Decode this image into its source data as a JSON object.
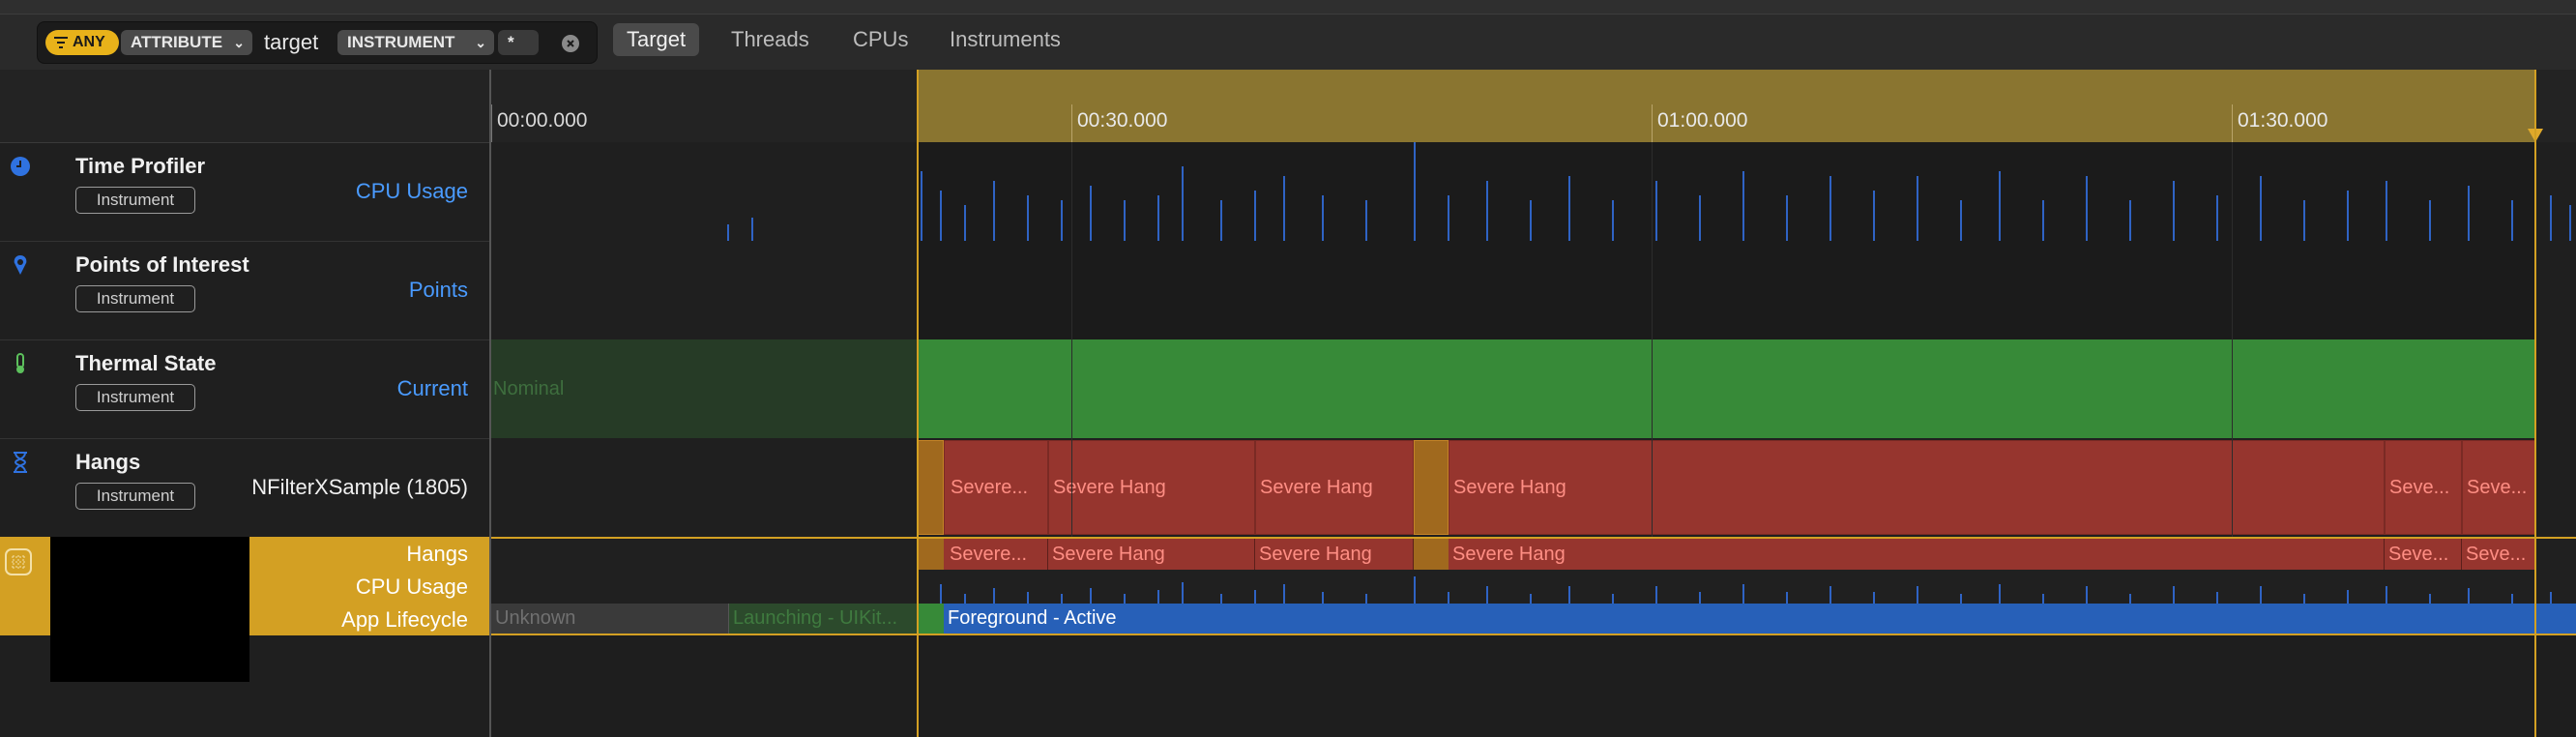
{
  "filter": {
    "any_label": "ANY",
    "attribute_label": "ATTRIBUTE",
    "target_text": "target",
    "instrument_label": "INSTRUMENT",
    "star_label": "*"
  },
  "tabs": [
    "Target",
    "Threads",
    "CPUs",
    "Instruments"
  ],
  "ruler": {
    "ticks": [
      "00:00.000",
      "00:30.000",
      "01:00.000",
      "01:30.000"
    ]
  },
  "tracks": [
    {
      "title": "Time Profiler",
      "badge": "Instrument",
      "right": "CPU Usage",
      "icon": "clock-icon"
    },
    {
      "title": "Points of Interest",
      "badge": "Instrument",
      "right": "Points",
      "icon": "pin-icon"
    },
    {
      "title": "Thermal State",
      "badge": "Instrument",
      "right": "Current",
      "icon": "thermometer-icon"
    },
    {
      "title": "Hangs",
      "badge": "Instrument",
      "right": "NFilterXSample (1805)",
      "icon": "hourglass-icon"
    }
  ],
  "subtracks": {
    "hangs": "Hangs",
    "cpu_usage": "CPU Usage",
    "app_lifecycle": "App Lifecycle"
  },
  "thermal": {
    "nominal_label": "Nominal"
  },
  "hang_labels": [
    "Severe...",
    "Severe Hang",
    "Severe Hang",
    "Severe Hang",
    "Seve...",
    "Seve..."
  ],
  "lifecycle": {
    "unknown": "Unknown",
    "launching": "Launching - UIKit...",
    "foreground": "Foreground - Active"
  },
  "colors": {
    "accent_blue": "#4a9bff",
    "selection_gold": "#e0a92a",
    "hang_red": "#96352e",
    "thermal_green": "#378a38",
    "foreground_blue": "#2760b8"
  }
}
